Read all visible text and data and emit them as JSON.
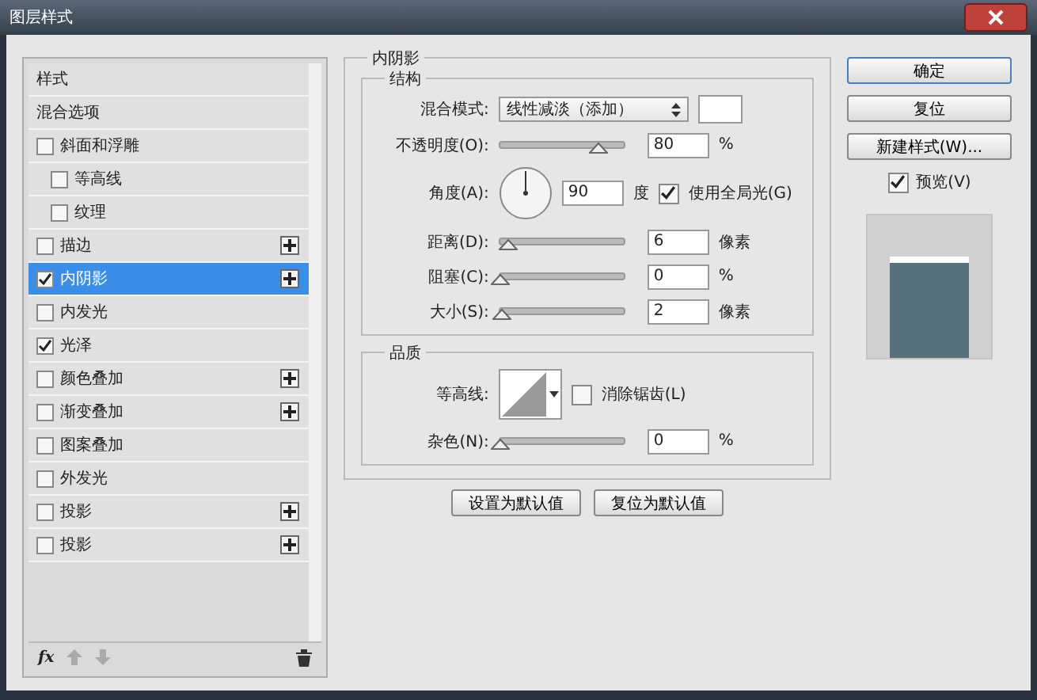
{
  "window": {
    "title": "图层样式"
  },
  "styles": [
    {
      "label": "样式",
      "kind": "header",
      "selected": false
    },
    {
      "label": "混合选项",
      "kind": "header",
      "selected": false
    },
    {
      "label": "斜面和浮雕",
      "kind": "check",
      "checked": false,
      "selected": false,
      "children": [
        {
          "label": "等高线",
          "kind": "check",
          "checked": false,
          "selected": false
        },
        {
          "label": "纹理",
          "kind": "check",
          "checked": false,
          "selected": false
        }
      ]
    },
    {
      "label": "描边",
      "kind": "check",
      "checked": false,
      "selected": false,
      "addable": true
    },
    {
      "label": "内阴影",
      "kind": "check",
      "checked": true,
      "selected": true,
      "addable": true
    },
    {
      "label": "内发光",
      "kind": "check",
      "checked": false,
      "selected": false
    },
    {
      "label": "光泽",
      "kind": "check",
      "checked": true,
      "selected": false
    },
    {
      "label": "颜色叠加",
      "kind": "check",
      "checked": false,
      "selected": false,
      "addable": true
    },
    {
      "label": "渐变叠加",
      "kind": "check",
      "checked": false,
      "selected": false,
      "addable": true
    },
    {
      "label": "图案叠加",
      "kind": "check",
      "checked": false,
      "selected": false
    },
    {
      "label": "外发光",
      "kind": "check",
      "checked": false,
      "selected": false
    },
    {
      "label": "投影",
      "kind": "check",
      "checked": false,
      "selected": false,
      "addable": true
    },
    {
      "label": "投影",
      "kind": "check",
      "checked": false,
      "selected": false,
      "addable": true
    }
  ],
  "fx_label": "fx",
  "panel": {
    "title": "内阴影",
    "structure": {
      "title": "结构",
      "rows": [
        {
          "kind": "select",
          "label": "混合模式:",
          "value": "线性减淡（添加）"
        },
        {
          "kind": "slider",
          "label": "不透明度(O):",
          "level": 0.8,
          "value": "80",
          "unit": "%"
        },
        {
          "kind": "angle",
          "label": "角度(A):",
          "value": "90",
          "unit": "度",
          "check_label": "使用全局光(G)",
          "checked": true
        },
        {
          "kind": "slider",
          "label": "距离(D):",
          "level": 0.06,
          "value": "6",
          "unit": "像素"
        },
        {
          "kind": "slider",
          "label": "阻塞(C):",
          "level": 0,
          "value": "0",
          "unit": "%"
        },
        {
          "kind": "slider",
          "label": "大小(S):",
          "level": 0.02,
          "value": "2",
          "unit": "像素"
        }
      ]
    },
    "quality": {
      "title": "品质",
      "rows": [
        {
          "kind": "contour",
          "label": "等高线:",
          "check_label": "消除锯齿(L)",
          "checked": false
        },
        {
          "kind": "slider",
          "label": "杂色(N):",
          "level": 0,
          "value": "0",
          "unit": "%"
        }
      ]
    },
    "buttons": [
      "设置为默认值",
      "复位为默认值"
    ]
  },
  "actions": [
    "确定",
    "复位",
    "新建样式(W)..."
  ],
  "preview": {
    "label": "预览(V)",
    "checked": true
  }
}
